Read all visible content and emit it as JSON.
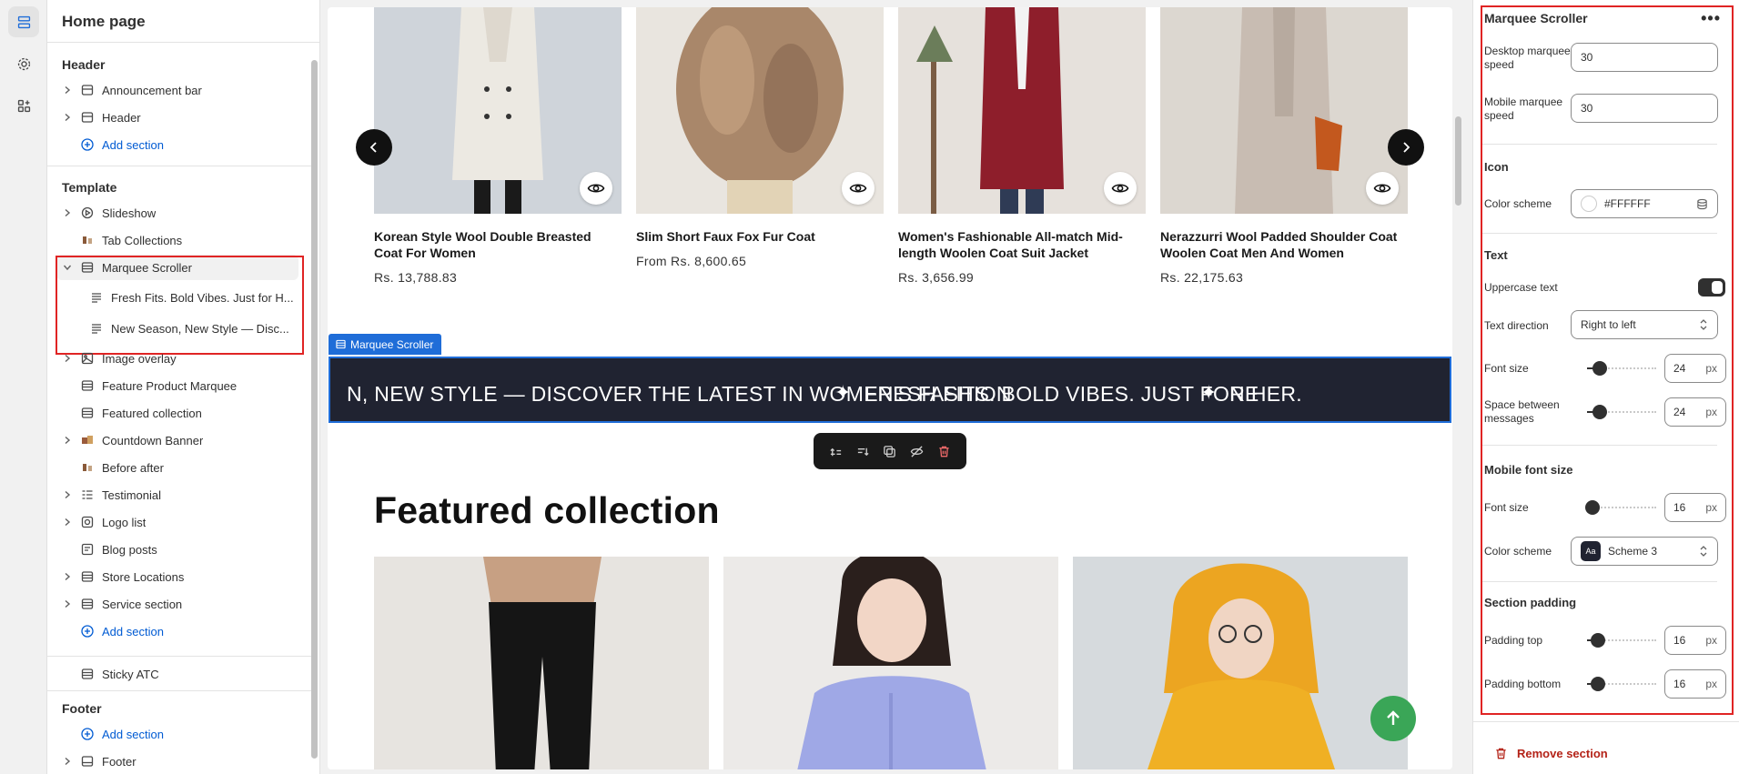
{
  "sidebar": {
    "title": "Home page",
    "groups": {
      "header_title": "Header",
      "template_title": "Template",
      "footer_title": "Footer"
    },
    "header_items": [
      "Announcement bar",
      "Header"
    ],
    "add_section": "Add section",
    "template_items": [
      "Slideshow",
      "Tab Collections",
      "Marquee Scroller"
    ],
    "marquee_blocks": [
      "Fresh Fits. Bold Vibes. Just for H...",
      "New Season, New Style — Disc..."
    ],
    "template_items_rest": [
      "Image overlay",
      "Feature Product Marquee",
      "Featured collection",
      "Countdown Banner",
      "Before after",
      "Testimonial",
      "Logo list",
      "Blog posts",
      "Store Locations",
      "Service section"
    ],
    "sticky": "Sticky ATC",
    "footer_items": [
      "Footer"
    ]
  },
  "preview": {
    "products": [
      {
        "title": "Korean Style Wool Double Breasted Coat For Women",
        "price": "Rs. 13,788.83"
      },
      {
        "title": "Slim Short Faux Fox Fur Coat",
        "price": "From Rs. 8,600.65"
      },
      {
        "title": "Women's Fashionable All-match Mid-length Woolen Coat Suit Jacket",
        "price": "Rs. 3,656.99"
      },
      {
        "title": "Nerazzurri Wool Padded Shoulder Coat Woolen Coat Men And Women",
        "price": "Rs. 22,175.63"
      }
    ],
    "marquee_tag": "Marquee Scroller",
    "marquee_segments": [
      "N, NEW STYLE — DISCOVER THE LATEST IN WOMEN'S FASHION",
      "FRESH FITS. BOLD VIBES. JUST FOR HER.",
      "NE"
    ],
    "separator": "✦",
    "featured_title": "Featured collection"
  },
  "settings": {
    "title": "Marquee Scroller",
    "more": "•••",
    "desktop_speed_label": "Desktop marquee speed",
    "desktop_speed": "30",
    "mobile_speed_label": "Mobile marquee speed",
    "mobile_speed": "30",
    "icon_heading": "Icon",
    "icon_color_label": "Color scheme",
    "icon_color_value": "#FFFFFF",
    "text_heading": "Text",
    "uppercase_label": "Uppercase text",
    "uppercase_on": true,
    "direction_label": "Text direction",
    "direction_value": "Right to left",
    "font_size_label": "Font size",
    "font_size": "24",
    "space_label": "Space between messages",
    "space_value": "24",
    "mobile_font_heading": "Mobile font size",
    "mobile_font_label": "Font size",
    "mobile_font_size": "16",
    "color_scheme_label": "Color scheme",
    "color_scheme_value": "Scheme 3",
    "color_scheme_badge": "Aa",
    "padding_heading": "Section padding",
    "padding_top_label": "Padding top",
    "padding_top": "16",
    "padding_bottom_label": "Padding bottom",
    "padding_bottom": "16",
    "unit": "px",
    "remove_label": "Remove section"
  },
  "colors": {
    "accent_blue": "#1f6dd8",
    "highlight_red": "#e02424",
    "marquee_bg": "#202331",
    "fab_green": "#3aa657"
  }
}
